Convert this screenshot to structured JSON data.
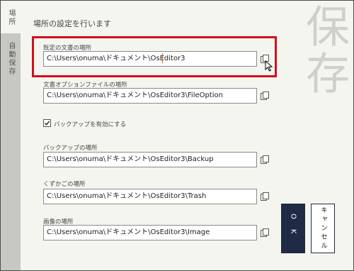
{
  "sidebar": {
    "tabs": [
      {
        "label": "場所",
        "active": true
      },
      {
        "label": "自動保存",
        "active": false
      }
    ]
  },
  "watermark": "保存",
  "page_title": "場所の設定を行います",
  "fields": [
    {
      "label": "既定の文書の場所",
      "value": "C:\\Users\\onuma\\ドキュメント\\OsEditor3"
    },
    {
      "label": "文書オプションファイルの場所",
      "value": "C:\\Users\\onuma\\ドキュメント\\OsEditor3\\FileOption"
    },
    {
      "label": "バックアップの場所",
      "value": "C:\\Users\\onuma\\ドキュメント\\OsEditor3\\Backup"
    },
    {
      "label": "くずかごの場所",
      "value": "C:\\Users\\onuma\\ドキュメント\\OsEditor3\\Trash"
    },
    {
      "label": "画像の場所",
      "value": "C:\\Users\\onuma\\ドキュメント\\OsEditor3\\Image"
    }
  ],
  "backup_checkbox": {
    "label": "バックアップを有効にする",
    "checked": true
  },
  "buttons": {
    "ok": "OK",
    "cancel": "キャンセル"
  },
  "icons": {
    "copy": "copy-icon",
    "check": "check-icon",
    "cursor": "mouse-pointer-icon"
  },
  "colors": {
    "highlight": "#d0101a",
    "ok_bg": "#1f2a44",
    "sidebar_bg": "#c8c8c3",
    "watermark": "#cfcfcc"
  }
}
